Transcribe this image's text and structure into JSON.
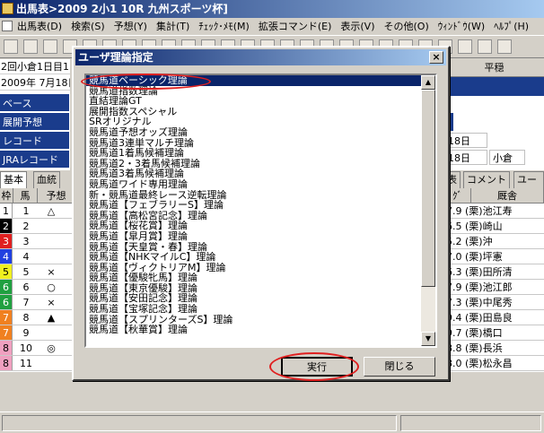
{
  "window": {
    "title": "出馬表>2009 2小1 10R 九州スポーツ杯]"
  },
  "menu": [
    "出馬表(D)",
    "検索(S)",
    "予想(Y)",
    "集計(T)",
    "ﾁｪｯｸ･ﾒﾓ(M)",
    "拡張コマンド(E)",
    "表示(V)",
    "その他(O)",
    "ｳｨﾝﾄﾞｳ(W)",
    "ﾍﾙﾌﾟ(H)"
  ],
  "left_info": [
    "2回小倉1日目1",
    "2009年 7月18日"
  ],
  "left_buttons": [
    "ベース",
    "展開予想",
    "レコード",
    "JRAレコード"
  ],
  "left_tabs": [
    "基本",
    "血統"
  ],
  "grid_headers": [
    "枠",
    "馬",
    "予想"
  ],
  "rows": [
    {
      "waku": "1",
      "uma": "1",
      "yoso": "△",
      "color": "#ffffff",
      "tcolor": "#000000",
      "right": "7.9 (栗)池江寿"
    },
    {
      "waku": "2",
      "uma": "2",
      "yoso": "",
      "color": "#000000",
      "tcolor": "#ffffff",
      "right": "6.5 (栗)崎山"
    },
    {
      "waku": "3",
      "uma": "3",
      "yoso": "",
      "color": "#e02020",
      "tcolor": "#ffffff",
      "right": "5.2 (栗)沖"
    },
    {
      "waku": "4",
      "uma": "4",
      "yoso": "",
      "color": "#2040e0",
      "tcolor": "#ffffff",
      "right": "7.0 (栗)坪憲"
    },
    {
      "waku": "5",
      "uma": "5",
      "yoso": "×",
      "color": "#f0f020",
      "tcolor": "#000000",
      "right": "6.3 (栗)田所清"
    },
    {
      "waku": "6",
      "uma": "6",
      "yoso": "○",
      "color": "#20a040",
      "tcolor": "#ffffff",
      "right": "7.9 (栗)池江郎"
    },
    {
      "waku": "6",
      "uma": "7",
      "yoso": "×",
      "color": "#20a040",
      "tcolor": "#ffffff",
      "right": "7.3 (栗)中尾秀"
    },
    {
      "waku": "7",
      "uma": "8",
      "yoso": "▲",
      "color": "#f08020",
      "tcolor": "#ffffff",
      "right": "9.4 (栗)田島良"
    },
    {
      "waku": "7",
      "uma": "9",
      "yoso": "",
      "color": "#f08020",
      "tcolor": "#ffffff",
      "right": "9.7 (栗)橋口"
    },
    {
      "waku": "8",
      "uma": "10",
      "yoso": "◎",
      "color": "#f0a0c0",
      "tcolor": "#000000",
      "right": "8.8 (栗)長浜"
    },
    {
      "waku": "8",
      "uma": "11",
      "yoso": "",
      "color": "#f0a0c0",
      "tcolor": "#000000",
      "right": "8.0 (栗)松永昌"
    }
  ],
  "right_info": {
    "header": "平穏",
    "date1": "18日",
    "date2": "18日",
    "place": "小倉"
  },
  "right_tabs": [
    "表",
    "コメント",
    "ユーザ"
  ],
  "right_headers": [
    "ｸﾞ",
    "厩舎"
  ],
  "dialog": {
    "title": "ユーザ理論指定",
    "close": "×",
    "items": [
      "競馬道ベーシック理論",
      "競馬道指数理論",
      "直結理論GT",
      "展開指数スペシャル",
      "SRオリジナル",
      "競馬道予想オッズ理論",
      "競馬道3連単マルチ理論",
      "競馬道1着馬候補理論",
      "競馬道2・3着馬候補理論",
      "競馬道3着馬候補理論",
      "競馬道ワイド専用理論",
      "新・競馬道最終レース逆転理論",
      "競馬道【フェブラリーS】理論",
      "競馬道【高松宮記念】理論",
      "競馬道【桜花賞】理論",
      "競馬道【皐月賞】理論",
      "競馬道【天皇賞・春】理論",
      "競馬道【NHKマイルC】理論",
      "競馬道【ヴィクトリアM】理論",
      "競馬道【優駿牝馬】理論",
      "競馬道【東京優駿】理論",
      "競馬道【安田記念】理論",
      "競馬道【宝塚記念】理論",
      "競馬道【スプリンターズS】理論",
      "競馬道【秋華賞】理論"
    ],
    "execute": "実行",
    "close_button": "閉じる"
  },
  "colors": {
    "title": "#0a246a",
    "selection": "#0a246a",
    "panel_button": "#1a3c8c",
    "highlight": "#e02020"
  }
}
